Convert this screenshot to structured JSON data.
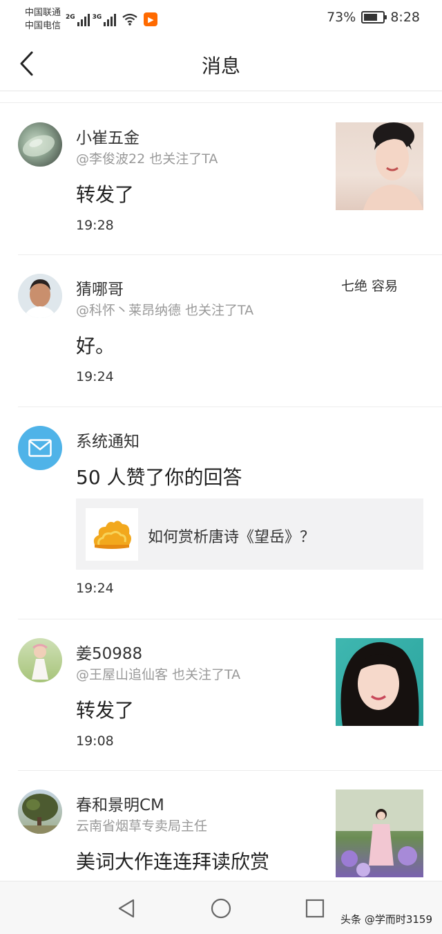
{
  "status_bar": {
    "carrier_1": "中国联通",
    "carrier_2": "中国电信",
    "sim1_type": "2G",
    "sim2_type": "3G",
    "battery_percent_text": "73%",
    "battery_level": 0.73,
    "time": "8:28",
    "app_badge_icon": "video-app-icon"
  },
  "header": {
    "back_icon": "back-arrow-icon",
    "title": "消息"
  },
  "messages": [
    {
      "name": "小崔五金",
      "subtitle": "@李俊波22 也关注了TA",
      "body": "转发了",
      "time": "19:28",
      "has_thumbnail": true
    },
    {
      "name": "猜哪哥",
      "subtitle": "@科怀丶莱昂纳德 也关注了TA",
      "body": "好。",
      "time": "19:24",
      "right_text": "七绝 容易"
    },
    {
      "name": "系统通知",
      "body": "50 人赞了你的回答",
      "quote": "如何赏析唐诗《望岳》？",
      "time": "19:24",
      "icon": "mail-icon"
    },
    {
      "name": "姜50988",
      "subtitle": "@王屋山追仙客 也关注了TA",
      "body": "转发了",
      "time": "19:08",
      "has_thumbnail": true
    },
    {
      "name": "春和景明CM",
      "subtitle": "云南省烟草专卖局主任",
      "body": "美词大作连连拜读欣赏",
      "has_thumbnail": true
    }
  ],
  "bottom_nav": {
    "back_icon": "triangle-back-icon",
    "home_icon": "circle-home-icon",
    "recent_icon": "square-recent-icon"
  },
  "watermark": "头条 @学而时3159",
  "colors": {
    "system_icon_bg": "#4fb3e8",
    "app_badge": "#ff6a00",
    "card_bg": "#f2f2f3"
  }
}
